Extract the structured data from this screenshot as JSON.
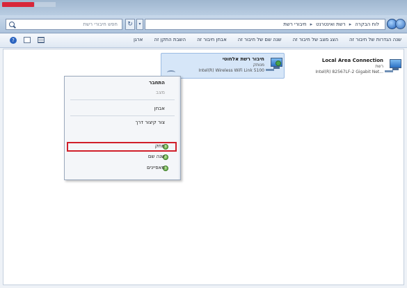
{
  "window": {
    "title_block": "",
    "accent": "#d8263a"
  },
  "addressbar": {
    "search_placeholder": "חפש חיבורי רשת",
    "refresh_glyph": "↻",
    "dropdown_glyph": "▾",
    "breadcrumbs": [
      "לוח הבקרה",
      "רשת ואינטרנט",
      "חיבורי רשת"
    ],
    "breadcrumb_sep": "▸"
  },
  "commandbar": {
    "items": [
      "ארגן",
      "השבת התקן זה",
      "אבחן חיבור זה",
      "שנה שם של חיבור זה",
      "הצג מצב של חיבור זה",
      "שנה הגדרות של חיבור זה"
    ]
  },
  "adapters": {
    "lan": {
      "name": "Local Area Connection",
      "status": "רשת",
      "device": "Intel(R) 82567LF-2 Gigabit Net..."
    },
    "wifi": {
      "name": "חיבור רשת אלחוטי",
      "status": "מנותק",
      "device": "Intel(R) Wireless WiFi Link 5100"
    }
  },
  "context_menu": {
    "items": [
      {
        "label": "התחבר",
        "style": "bold"
      },
      {
        "label": "מצב",
        "style": "disabled"
      },
      {
        "label": "אבחן",
        "style": "normal"
      },
      {
        "label": "צור קיצור דרך",
        "style": "normal"
      },
      {
        "label": "מחק",
        "style": "normal"
      },
      {
        "label": "שנה שם",
        "style": "normal"
      },
      {
        "label": "מאפיינים",
        "style": "normal"
      }
    ],
    "highlighted": "מחק"
  }
}
